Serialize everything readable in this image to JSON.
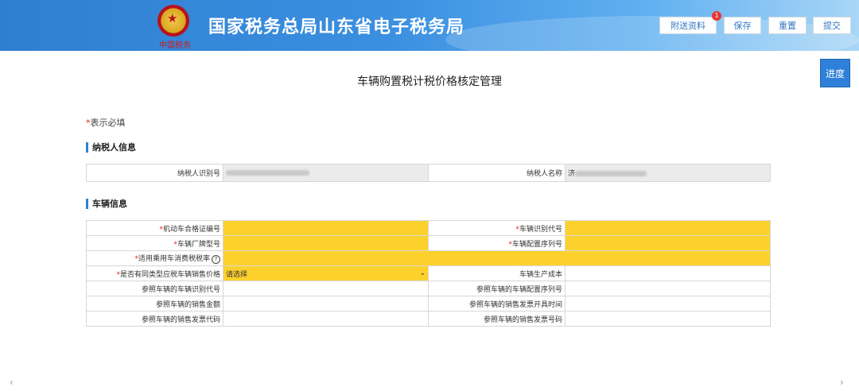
{
  "header": {
    "emblem_text": "中国税务",
    "title": "国家税务总局山东省电子税务局",
    "buttons": {
      "attachments": "附送资料",
      "save": "保存",
      "reset": "重置",
      "submit": "提交"
    },
    "badge_count": "1"
  },
  "progress_label": "进度",
  "page_title": "车辆购置税计税价格核定管理",
  "required_note": {
    "star": "*",
    "text": "表示必填"
  },
  "taxpayer_section": {
    "title": "纳税人信息",
    "id_label": "纳税人识别号",
    "name_label": "纳税人名称",
    "name_prefix": "济"
  },
  "vehicle_section": {
    "title": "车辆信息",
    "rows": [
      {
        "left_label": "机动车合格证编号",
        "left_required": true,
        "right_label": "车辆识别代号",
        "right_required": true
      },
      {
        "left_label": "车辆厂牌型号",
        "left_required": true,
        "right_label": "车辆配置序列号",
        "right_required": true
      },
      {
        "left_label": "适用乘用车消费税税率",
        "left_required": true
      },
      {
        "left_label": "是否有同类型应税车辆销售价格",
        "left_required": true,
        "select_value": "请选择",
        "right_label": "车辆生产成本",
        "right_required": false
      },
      {
        "left_label": "参照车辆的车辆识别代号",
        "left_required": false,
        "right_label": "参照车辆的车辆配置序列号",
        "right_required": false
      },
      {
        "left_label": "参照车辆的销售金额",
        "left_required": false,
        "right_label": "参照车辆的销售发票开具时间",
        "right_required": false
      },
      {
        "left_label": "参照车辆的销售发票代码",
        "left_required": false,
        "right_label": "参照车辆的销售发票号码",
        "right_required": false
      }
    ]
  },
  "icons": [
    "national-emblem-icon",
    "help-icon",
    "chevron-down-icon",
    "scroll-left-icon",
    "scroll-right-icon"
  ],
  "colors": {
    "header_blue": "#2f7fd0",
    "required_yellow": "#fdd12c",
    "accent_blue": "#2f80d8",
    "required_red": "#e02020"
  }
}
